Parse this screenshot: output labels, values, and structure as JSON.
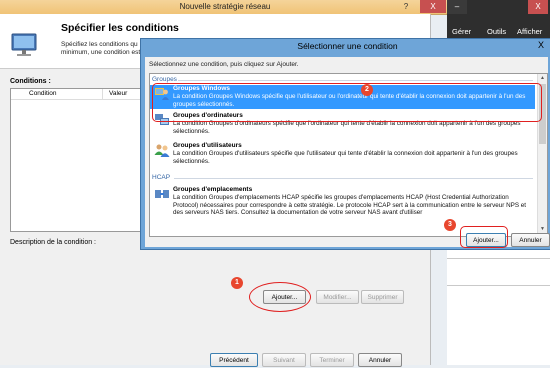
{
  "main_window": {
    "title": "Nouvelle stratégie réseau",
    "help_btn": "?",
    "close_btn": "X",
    "heading": "Spécifier les conditions",
    "description": "Spécifiez les conditions qu\nminimum, une condition est",
    "conditions_label": "Conditions :",
    "columns": [
      "Condition",
      "Valeur"
    ],
    "description_label": "Description de la condition :",
    "buttons": {
      "add": "Ajouter...",
      "modify": "Modifier...",
      "delete": "Supprimer"
    },
    "nav": {
      "previous": "Précédent",
      "next": "Suivant",
      "finish": "Terminer",
      "cancel": "Annuler"
    }
  },
  "right_app": {
    "minimize": "–",
    "close": "X",
    "menu": [
      "Gérer",
      "Outils",
      "Afficher"
    ]
  },
  "dialog": {
    "title": "Sélectionner une condition",
    "close_btn": "X",
    "instruction": "Sélectionnez une condition, puis cliquez sur Ajouter.",
    "groups": [
      {
        "name": "Groupes",
        "items": [
          {
            "title": "Groupes Windows",
            "description": "La condition Groupes Windows spécifie que l'utilisateur ou l'ordinateur qui tente d'établir la connexion doit appartenir à l'un des groupes sélectionnés.",
            "selected": true,
            "icon": "users-group-icon"
          },
          {
            "title": "Groupes d'ordinateurs",
            "description": "La condition Groupes d'ordinateurs spécifie que l'ordinateur qui tente d'établir la connexion doit appartenir à l'un des groupes sélectionnés.",
            "selected": false,
            "icon": "computers-group-icon"
          },
          {
            "title": "Groupes d'utilisateurs",
            "description": "La condition Groupes d'utilisateurs spécifie que l'utilisateur qui tente d'établir la connexion doit appartenir à l'un des groupes sélectionnés.",
            "selected": false,
            "icon": "users-icon"
          }
        ]
      },
      {
        "name": "HCAP",
        "items": [
          {
            "title": "Groupes d'emplacements",
            "description": "La condition Groupes d'emplacements HCAP spécifie les groupes d'emplacements HCAP (Host Credential Authorization Protocol) nécessaires pour correspondre à cette stratégie. Le protocole HCAP sert à la communication entre le serveur NPS et des serveurs NAS tiers. Consultez la documentation de votre serveur NAS avant d'utiliser",
            "selected": false,
            "icon": "location-group-icon"
          }
        ]
      }
    ],
    "buttons": {
      "add": "Ajouter...",
      "cancel": "Annuler"
    }
  },
  "annotations": {
    "step_add_main": "1",
    "step_select": "2",
    "step_add_dialog": "3",
    "color": "#e02020"
  }
}
